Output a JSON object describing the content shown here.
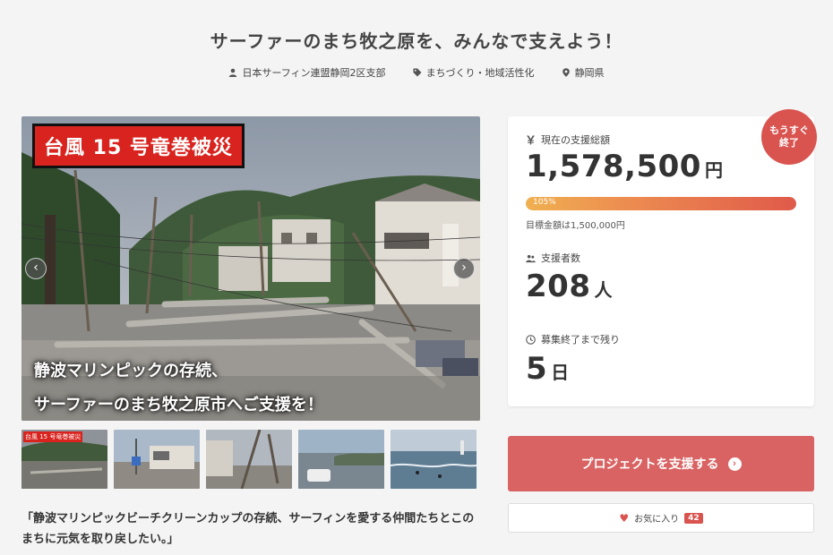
{
  "project": {
    "title": "サーファーのまち牧之原を、みんなで支えよう！",
    "owner": "日本サーフィン連盟静岡2区支部",
    "category": "まちづくり・地域活性化",
    "location": "静岡県"
  },
  "hero": {
    "badge": "台風 15 号竜巻被災",
    "caption_line1": "静波マリンピックの存続、",
    "caption_line2": "サーファーのまち牧之原市へご支援を！",
    "prev_arrow": "‹",
    "next_arrow": "›"
  },
  "thumbnails": [
    {
      "label": "台風 15 号竜巻被災"
    },
    {
      "label": ""
    },
    {
      "label": ""
    },
    {
      "label": ""
    },
    {
      "label": ""
    }
  ],
  "quote": "「静波マリンピックビーチクリーンカップの存続、サーフィンを愛する仲間たちとこのまちに元気を取り戻したい。」",
  "stats": {
    "soon_line1": "もうすぐ",
    "soon_line2": "終了",
    "total_label": "現在の支援総額",
    "total_amount": "1,578,500",
    "total_unit": "円",
    "progress_text": "105%",
    "progress_percent": 105,
    "goal_text": "目標金額は1,500,000円",
    "supporters_label": "支援者数",
    "supporters_count": "208",
    "supporters_unit": "人",
    "remaining_label": "募集終了まで残り",
    "remaining_days": "5",
    "remaining_unit": "日"
  },
  "actions": {
    "support_label": "プロジェクトを支援する",
    "support_icon": "›",
    "favorite_label": "お気に入り",
    "favorite_icon": "♥",
    "favorite_count": "42"
  },
  "colors": {
    "accent": "#d96262",
    "badge_red": "#d8231e",
    "soon_red": "#d9534f"
  }
}
